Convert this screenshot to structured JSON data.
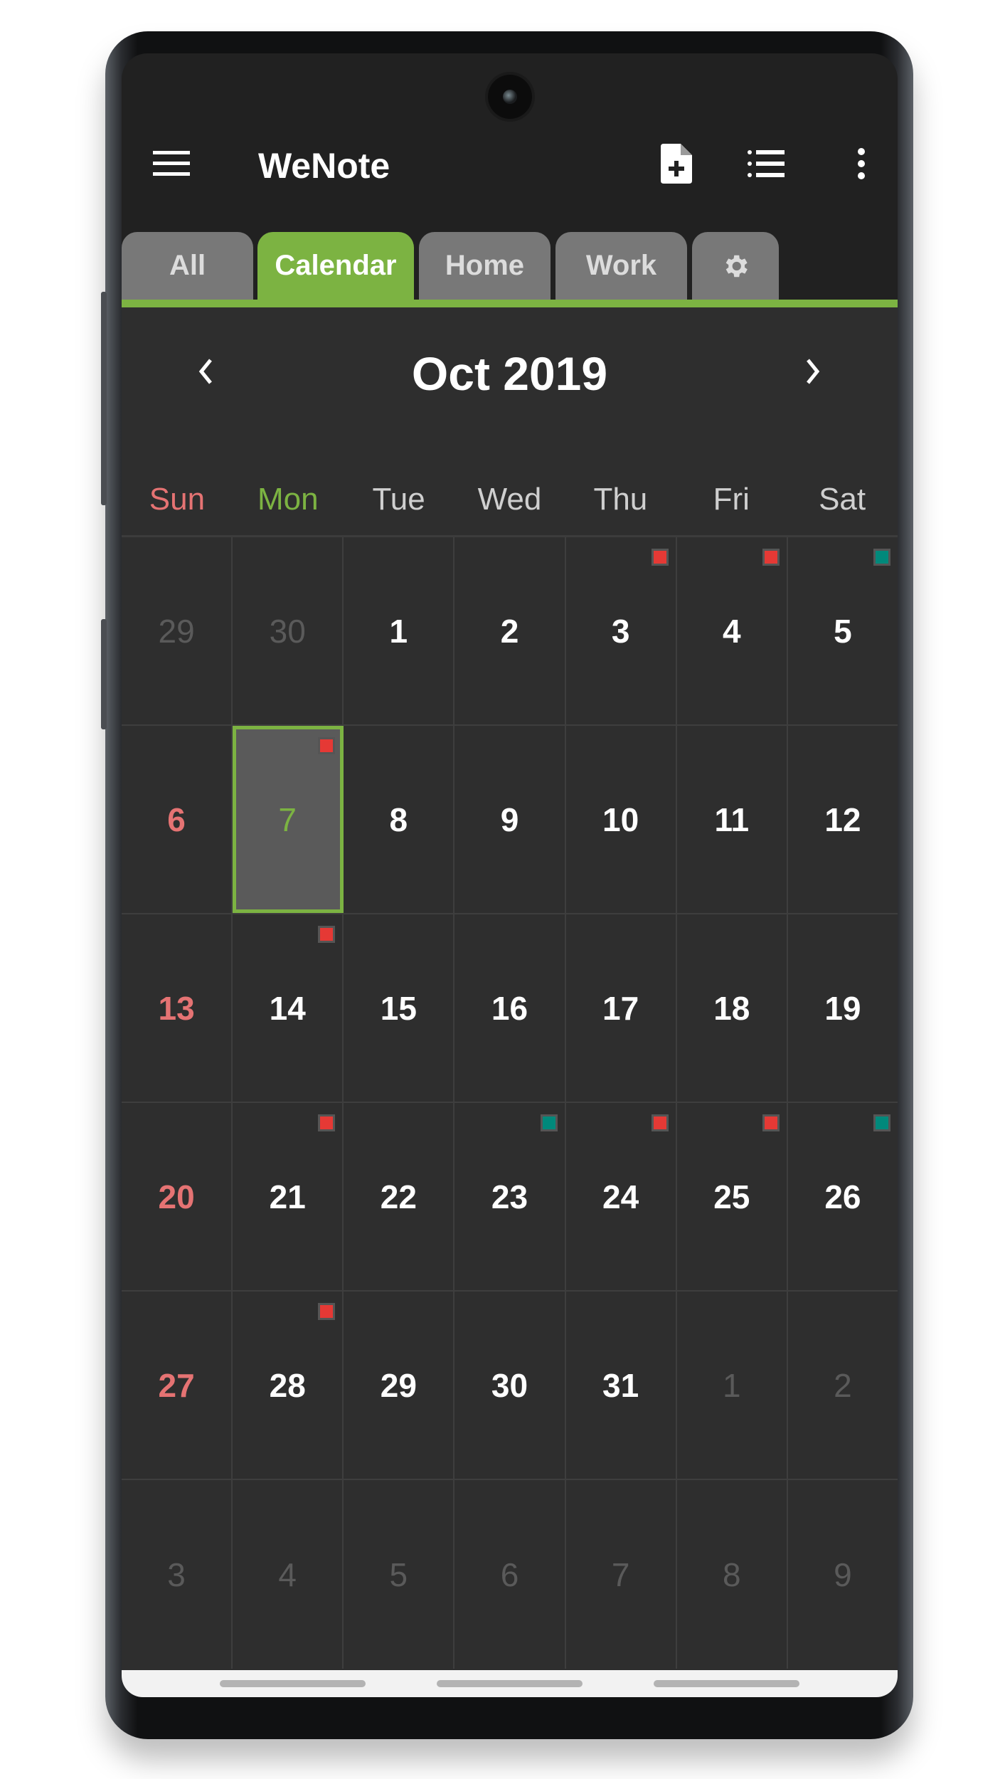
{
  "app": {
    "title": "WeNote",
    "accent_color": "#7cb342",
    "toolbar_icons": [
      "menu-icon",
      "new-note-icon",
      "list-view-icon",
      "more-options-icon"
    ]
  },
  "tabs": [
    {
      "label": "All",
      "active": false
    },
    {
      "label": "Calendar",
      "active": true
    },
    {
      "label": "Home",
      "active": false
    },
    {
      "label": "Work",
      "active": false
    },
    {
      "label": "",
      "icon": "settings-gear-icon",
      "active": false
    }
  ],
  "calendar": {
    "month_title": "Oct 2019",
    "prev_label": "‹",
    "next_label": "›",
    "weekdays": [
      "Sun",
      "Mon",
      "Tue",
      "Wed",
      "Thu",
      "Fri",
      "Sat"
    ],
    "selected_day": "7",
    "marker_colors": {
      "red": "#e53935",
      "teal": "#00897b"
    },
    "weeks": [
      [
        {
          "d": "29",
          "o": true
        },
        {
          "d": "30",
          "o": true
        },
        {
          "d": "1"
        },
        {
          "d": "2"
        },
        {
          "d": "3",
          "m": "red"
        },
        {
          "d": "4",
          "m": "red"
        },
        {
          "d": "5",
          "m": "teal"
        }
      ],
      [
        {
          "d": "6"
        },
        {
          "d": "7",
          "m": "red",
          "sel": true
        },
        {
          "d": "8"
        },
        {
          "d": "9"
        },
        {
          "d": "10"
        },
        {
          "d": "11"
        },
        {
          "d": "12"
        }
      ],
      [
        {
          "d": "13"
        },
        {
          "d": "14",
          "m": "red"
        },
        {
          "d": "15"
        },
        {
          "d": "16"
        },
        {
          "d": "17"
        },
        {
          "d": "18"
        },
        {
          "d": "19"
        }
      ],
      [
        {
          "d": "20"
        },
        {
          "d": "21",
          "m": "red"
        },
        {
          "d": "22"
        },
        {
          "d": "23",
          "m": "teal"
        },
        {
          "d": "24",
          "m": "red"
        },
        {
          "d": "25",
          "m": "red"
        },
        {
          "d": "26",
          "m": "teal"
        }
      ],
      [
        {
          "d": "27"
        },
        {
          "d": "28",
          "m": "red"
        },
        {
          "d": "29"
        },
        {
          "d": "30"
        },
        {
          "d": "31"
        },
        {
          "d": "1",
          "o": true
        },
        {
          "d": "2",
          "o": true
        }
      ],
      [
        {
          "d": "3",
          "o": true
        },
        {
          "d": "4",
          "o": true
        },
        {
          "d": "5",
          "o": true
        },
        {
          "d": "6",
          "o": true
        },
        {
          "d": "7",
          "o": true
        },
        {
          "d": "8",
          "o": true
        },
        {
          "d": "9",
          "o": true
        }
      ]
    ]
  }
}
